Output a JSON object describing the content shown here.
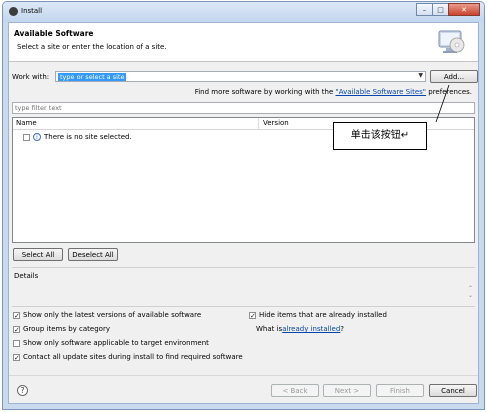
{
  "window": {
    "title": "Install",
    "controls": [
      "–",
      "□",
      "✕"
    ]
  },
  "header": {
    "title": "Available Software",
    "subtitle": "Select a site or enter the location of a site.",
    "icon": "monitor-cd-icon"
  },
  "work_with": {
    "label": "Work with:",
    "placeholder": "type or select a site",
    "add_button": "Add...",
    "find_more_prefix": "Find more software by working with the ",
    "find_more_link": "\"Available Software Sites\"",
    "find_more_suffix": " preferences."
  },
  "filter": {
    "placeholder": "type filter text"
  },
  "table": {
    "columns": [
      "Name",
      "Version"
    ],
    "rows": [
      {
        "label": "There is no site selected."
      }
    ]
  },
  "buttons": {
    "select_all": "Select All",
    "deselect_all": "Deselect All"
  },
  "details": {
    "label": "Details"
  },
  "options": {
    "latest_versions": "Show only the latest versions of available software",
    "group_by_category": "Group items by category",
    "target_env": "Show only software applicable to target environment",
    "contact_sites": "Contact all update sites during install to find required software",
    "hide_installed": "Hide items that are already installed",
    "what_is_prefix": "What is ",
    "what_is_link": "already installed",
    "what_is_suffix": "?"
  },
  "footer": {
    "back": "< Back",
    "next": "Next >",
    "finish": "Finish",
    "cancel": "Cancel"
  },
  "annotation": {
    "text": "单击该按钮↵"
  }
}
